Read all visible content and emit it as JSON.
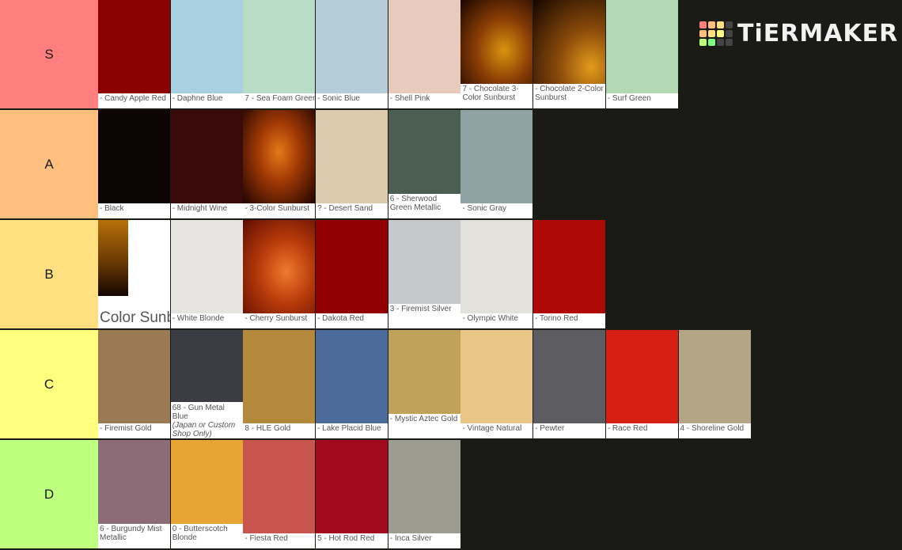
{
  "logo": {
    "text": "TiERMAKER",
    "grid_colors": [
      "#ff7f7f",
      "#ffbf7f",
      "#ffdf7f",
      "#444444",
      "#ffbf7f",
      "#ffdf7f",
      "#ffff7f",
      "#444444",
      "#bfff7f",
      "#7fff7f",
      "#444444",
      "#444444"
    ]
  },
  "tiers": [
    {
      "label": "S",
      "color": "#ff7f7f",
      "items": [
        {
          "caption": "- Candy Apple Red",
          "color": "#8b0000"
        },
        {
          "caption": "- Daphne Blue",
          "color": "#a9d0e1"
        },
        {
          "caption": "7 - Sea Foam Green",
          "color": "#b8dcc6"
        },
        {
          "caption": "- Sonic Blue",
          "color": "#b4cdd8"
        },
        {
          "caption": "- Shell Pink",
          "color": "#e8cbbd"
        },
        {
          "caption": "7 - Chocolate 3-Color Sunburst",
          "color": "#7a3a06",
          "gradient": "radial-gradient(ellipse at 60% 60%, #d9940e 0%, #8a3d05 45%, #1a0500 100%)"
        },
        {
          "caption": "- Chocolate 2-Color Sunburst",
          "color": "#6a3a08",
          "gradient": "radial-gradient(ellipse at 80% 80%, #e39b1c 0%, #8a4a0a 40%, #140600 100%)"
        },
        {
          "caption": "- Surf Green",
          "color": "#b2d8b4"
        }
      ]
    },
    {
      "label": "A",
      "color": "#ffbf7f",
      "items": [
        {
          "caption": "- Black",
          "color": "#0c0504"
        },
        {
          "caption": "- Midnight Wine",
          "color": "#3a0a0a"
        },
        {
          "caption": "- 3-Color Sunburst",
          "color": "#a03c06",
          "gradient": "radial-gradient(ellipse at 50% 45%, #e57a18 0%, #a33a05 40%, #1f0300 100%)"
        },
        {
          "caption": "? - Desert Sand",
          "color": "#dccbac"
        },
        {
          "caption": "6 - Sherwood Green Metallic",
          "color": "#4c5e52"
        },
        {
          "caption": "- Sonic Gray",
          "color": "#8fa3a5"
        }
      ]
    },
    {
      "label": "B",
      "color": "#ffdf7f",
      "items": [
        {
          "caption": "Color Sunburst",
          "color": "#6a3a04",
          "big": true
        },
        {
          "caption": "- White Blonde",
          "color": "#e6e4e0"
        },
        {
          "caption": "- Cherry Sunburst",
          "color": "#b6380a",
          "gradient": "radial-gradient(ellipse at 60% 55%, #f07a2e 0%, #b73a0a 45%, #5e0c02 100%)"
        },
        {
          "caption": "- Dakota Red",
          "color": "#900005"
        },
        {
          "caption": "3 - Firemist Silver",
          "color": "#c6c8cc"
        },
        {
          "caption": "- Olympic White",
          "color": "#e3e1dc"
        },
        {
          "caption": "- Torino Red",
          "color": "#ae0807"
        }
      ]
    },
    {
      "label": "C",
      "color": "#ffff7f",
      "items": [
        {
          "caption": "- Firemist Gold",
          "color": "#9a7a52"
        },
        {
          "caption": "68 - Gun Metal Blue",
          "sub": "(Japan or Custom Shop Only)",
          "color": "#3c3d44"
        },
        {
          "caption": "8 - HLE Gold",
          "color": "#b4893c"
        },
        {
          "caption": "- Lake Placid Blue",
          "color": "#4a6b9c"
        },
        {
          "caption": "- Mystic Aztec Gold",
          "color": "#c1a25a"
        },
        {
          "caption": "- Vintage Natural",
          "color": "#e9c685"
        },
        {
          "caption": "- Pewter",
          "color": "#5d5d61"
        },
        {
          "caption": "- Race Red",
          "color": "#d71e12"
        },
        {
          "caption": "4 - Shoreline Gold",
          "color": "#b3a585"
        }
      ]
    },
    {
      "label": "D",
      "color": "#bfff7f",
      "items": [
        {
          "caption": "6 - Burgundy Mist Metallic",
          "color": "#8c6c76"
        },
        {
          "caption": "0 - Butterscotch Blonde",
          "color": "#e8a534"
        },
        {
          "caption": "- Fiesta Red",
          "color": "#c8564f"
        },
        {
          "caption": "5 - Hot Rod Red",
          "color": "#a10a1c"
        },
        {
          "caption": "- Inca Silver",
          "color": "#9c9c90"
        }
      ]
    }
  ]
}
